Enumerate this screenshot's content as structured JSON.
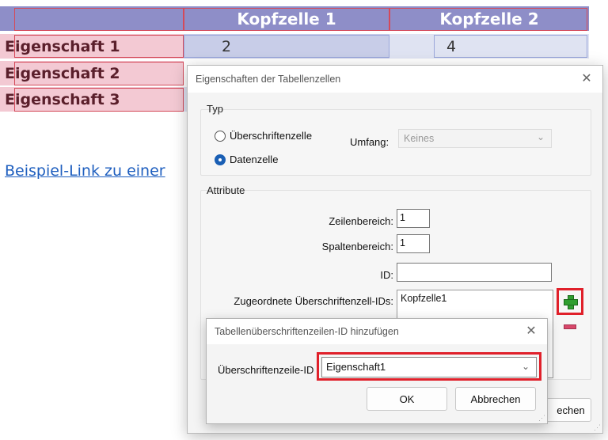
{
  "document": {
    "table": {
      "headers": [
        "",
        "Kopfzelle 1",
        "Kopfzelle 2"
      ],
      "rows": [
        {
          "head": "Eigenschaft 1",
          "values": [
            "2",
            "4"
          ]
        },
        {
          "head": "Eigenschaft 2",
          "values": [
            "",
            ""
          ]
        },
        {
          "head": "Eigenschaft 3",
          "values": [
            "",
            ""
          ]
        }
      ]
    },
    "link_text": "Beispiel-Link zu einer"
  },
  "dialog": {
    "title": "Eigenschaften der Tabellenzellen",
    "type_group": {
      "label": "Typ",
      "options": [
        "Überschriftenzelle",
        "Datenzelle"
      ],
      "selected": "Datenzelle",
      "scope_label": "Umfang:",
      "scope_value": "Keines"
    },
    "attributes_group": {
      "label": "Attribute",
      "row_span_label": "Zeilenbereich:",
      "row_span_value": "1",
      "col_span_label": "Spaltenbereich:",
      "col_span_value": "1",
      "id_label": "ID:",
      "id_value": "",
      "header_ids_label": "Zugeordnete Überschriftenzell-IDs:",
      "header_ids": [
        "Kopfzelle1"
      ]
    },
    "cancel_partial": "echen"
  },
  "subdialog": {
    "title": "Tabellenüberschriftenzeilen-ID hinzufügen",
    "field_label": "Überschriftenzeile-ID",
    "field_value": "Eigenschaft1",
    "ok_label": "OK",
    "cancel_label": "Abbrechen"
  },
  "colors": {
    "header_fill": "#8e8ec8",
    "row_text": "#5a1f2b",
    "highlight": "#e0202a",
    "link": "#1f5fbf"
  },
  "icons": [
    "close-icon",
    "chevron-down-icon",
    "add-icon",
    "remove-icon",
    "resize-grip-icon"
  ]
}
